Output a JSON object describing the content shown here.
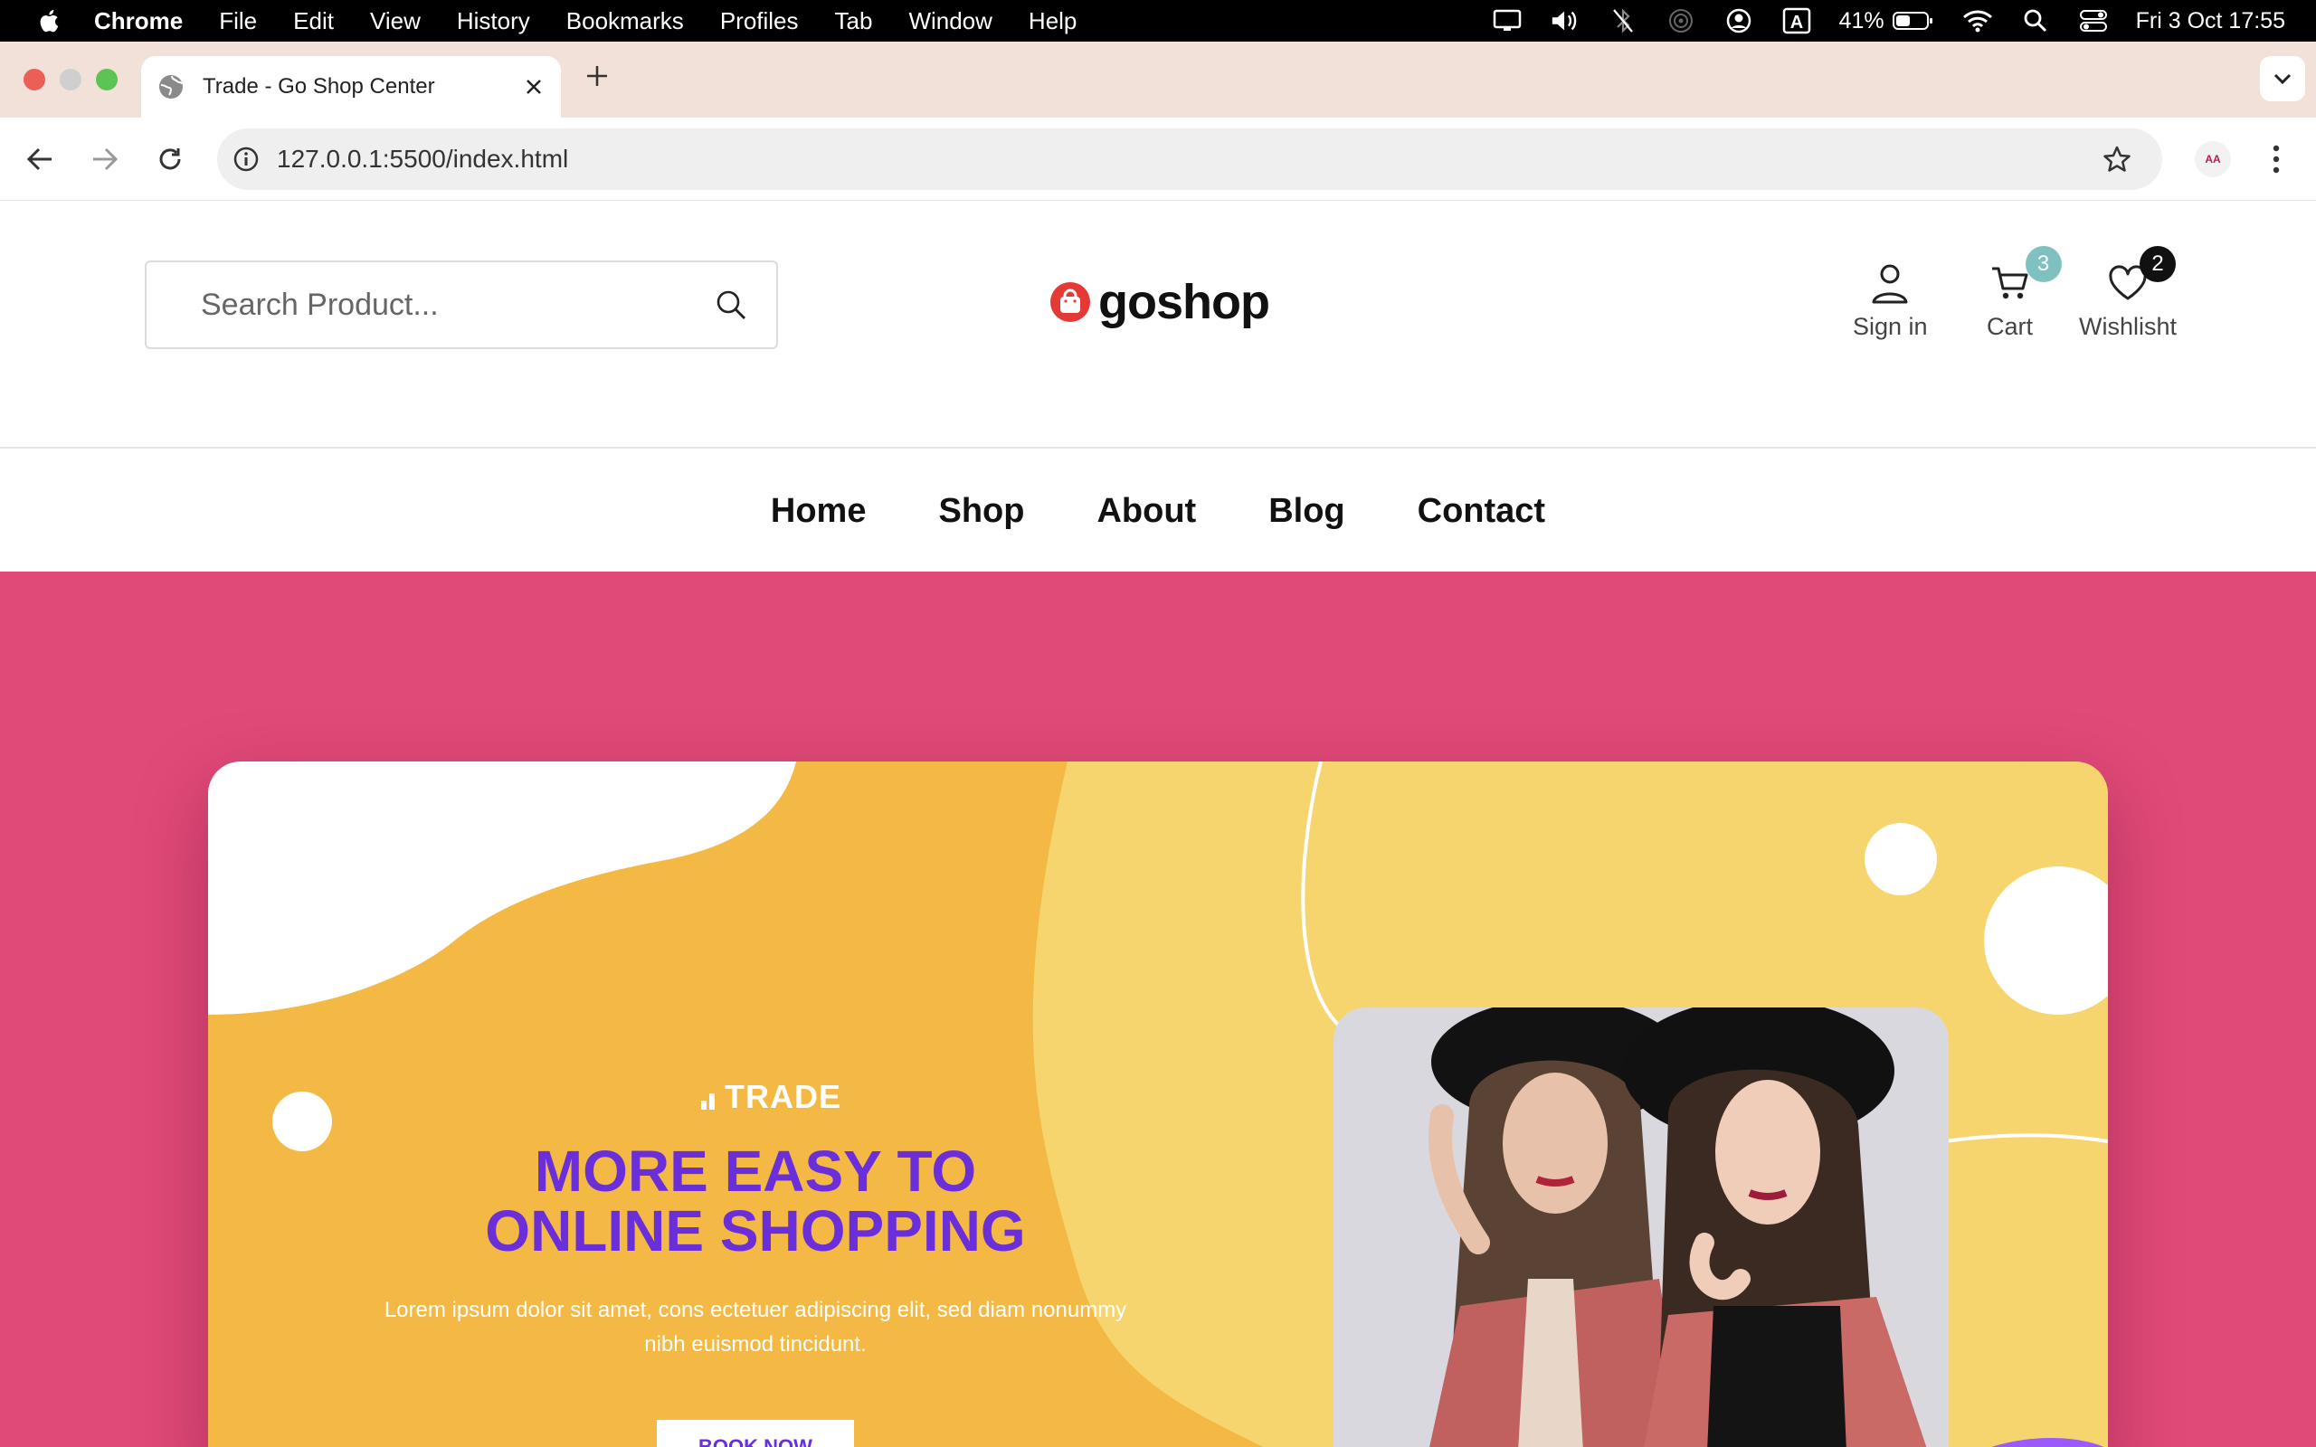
{
  "menubar": {
    "app": "Chrome",
    "items": [
      "File",
      "Edit",
      "View",
      "History",
      "Bookmarks",
      "Profiles",
      "Tab",
      "Window",
      "Help"
    ],
    "battery": "41%",
    "datetime": "Fri 3 Oct  17:55"
  },
  "browser": {
    "tab_title": "Trade - Go Shop Center",
    "url": "127.0.0.1:5500/index.html",
    "extension_label": "AA"
  },
  "header": {
    "search_placeholder": "Search Product...",
    "logo_text": "goshop",
    "signin_label": "Sign in",
    "cart_label": "Cart",
    "cart_count": "3",
    "wishlist_label": "Wishlisht",
    "wishlist_count": "2"
  },
  "nav": {
    "items": [
      "Home",
      "Shop",
      "About",
      "Blog",
      "Contact"
    ]
  },
  "hero": {
    "brand": "TRADE",
    "headline_line1": "MORE EASY TO",
    "headline_line2": "ONLINE SHOPPING",
    "subtext": "Lorem ipsum dolor sit amet, cons ectetuer adipiscing elit, sed diam nonummy nibh euismod tincidunt.",
    "button_label": "BOOK NOW"
  },
  "colors": {
    "hero_bg": "#e04a78",
    "card_orange": "#f4b944",
    "card_yellow": "#f7d56e",
    "headline": "#6b2fd9",
    "cart_badge": "#7fc1c0",
    "wishlist_badge": "#111111"
  }
}
